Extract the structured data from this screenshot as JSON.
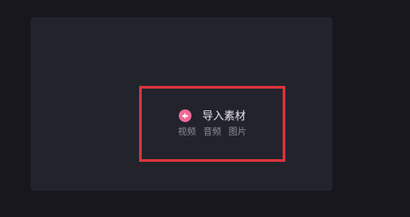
{
  "import_panel": {
    "label": "导入素材",
    "icon": "plus-circle-icon",
    "accent_color": "#f06a95",
    "highlight_color": "#d8343d",
    "media_types": [
      "视频",
      "音频",
      "图片"
    ]
  }
}
